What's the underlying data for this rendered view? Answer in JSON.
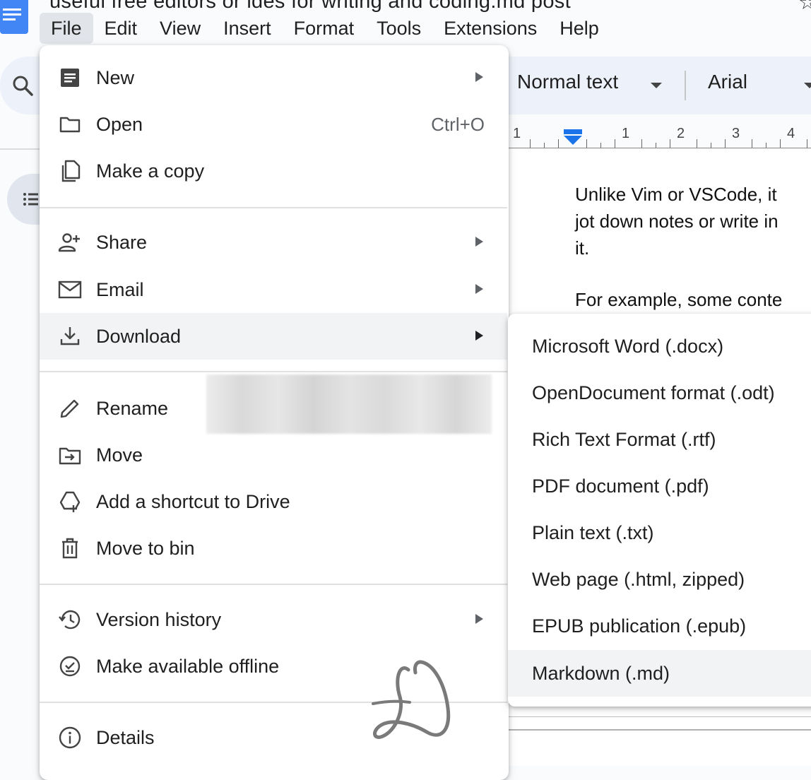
{
  "document": {
    "title": "useful free editors or ides for writing and coding.md post",
    "title_right": "☆",
    "paragraph1": [
      "Unlike Vim or VSCode, it",
      "jot down notes or write in",
      "it."
    ],
    "paragraph2": "For example, some conte"
  },
  "menubar": [
    "File",
    "Edit",
    "View",
    "Insert",
    "Format",
    "Tools",
    "Extensions",
    "Help"
  ],
  "toolbar": {
    "paragraph_style": "Normal text",
    "font": "Arial"
  },
  "ruler": [
    "1",
    "1",
    "2",
    "3",
    "4"
  ],
  "file_menu": {
    "new": "New",
    "open": "Open",
    "open_shortcut": "Ctrl+O",
    "make_copy": "Make a copy",
    "share": "Share",
    "email": "Email",
    "download": "Download",
    "rename": "Rename",
    "move": "Move",
    "add_shortcut": "Add a shortcut to Drive",
    "move_to_bin": "Move to bin",
    "version_history": "Version history",
    "make_offline": "Make available offline",
    "details": "Details"
  },
  "download_menu": [
    "Microsoft Word (.docx)",
    "OpenDocument format (.odt)",
    "Rich Text Format (.rtf)",
    "PDF document (.pdf)",
    "Plain text (.txt)",
    "Web page (.html, zipped)",
    "EPUB publication (.epub)",
    "Markdown (.md)"
  ],
  "colors": {
    "accent": "#4285f4",
    "highlight": "#f1f3f4",
    "menu_active": "#e1e5ea",
    "toolbar": "#edf2fa"
  }
}
